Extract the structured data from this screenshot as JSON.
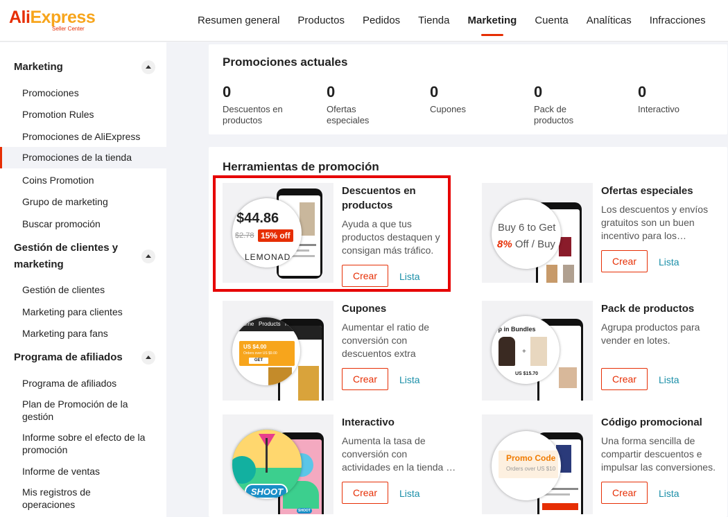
{
  "header": {
    "logo_main_a": "Ali",
    "logo_main_b": "Express",
    "logo_sub": "Seller Center",
    "nav": [
      "Resumen general",
      "Productos",
      "Pedidos",
      "Tienda",
      "Marketing",
      "Cuenta",
      "Analíticas",
      "Infracciones"
    ],
    "active_nav": "Marketing",
    "accent_color": "#e62e04"
  },
  "sidebar": {
    "sections": [
      {
        "title": "Marketing",
        "items": [
          "Promociones",
          "Promotion Rules",
          "Promociones de AliExpress",
          "Promociones de la tienda",
          "Coins Promotion",
          "Grupo de marketing",
          "Buscar promoción"
        ]
      },
      {
        "title": "Gestión de clientes y marketing",
        "items": [
          "Gestión de clientes",
          "Marketing para clientes",
          "Marketing para fans"
        ]
      },
      {
        "title": "Programa de afiliados",
        "items": [
          "Programa de afiliados",
          "Plan de Promoción de la gestión",
          "Informe sobre el efecto de la promoción",
          "Informe de ventas",
          "Mis registros de operaciones"
        ]
      }
    ],
    "active_item": "Promociones de la tienda"
  },
  "current": {
    "title": "Promociones actuales",
    "stats": [
      {
        "value": "0",
        "label": "Descuentos en productos"
      },
      {
        "value": "0",
        "label": "Ofertas especiales"
      },
      {
        "value": "0",
        "label": "Cupones"
      },
      {
        "value": "0",
        "label": "Pack de productos"
      },
      {
        "value": "0",
        "label": "Interactivo"
      }
    ]
  },
  "tools": {
    "title": "Herramientas de promoción",
    "crear_label": "Crear",
    "lista_label": "Lista",
    "items": [
      {
        "title": "Descuentos en productos",
        "desc": "Ayuda a que tus productos destaquen y consigan más tráfico.",
        "img": {
          "price": "$44.86",
          "old_price": "$2.78",
          "badge": "15% off",
          "caption": "LEMONAD"
        }
      },
      {
        "title": "Ofertas especiales",
        "desc": "Los descuentos y envíos gratuitos son un buen incentivo para los…",
        "img": {
          "line1": "Buy 6 to Get",
          "pct": "8%",
          "line2": " Off / Buy"
        }
      },
      {
        "title": "Cupones",
        "desc": "Aumentar el ratio de conversión con descuentos extra",
        "img": {
          "tab1": "Home",
          "tab2": "Products",
          "tab3": "Ne",
          "coupon": "US $4.00",
          "coupon_sub": "Orders over US $9.00",
          "get": "GET"
        }
      },
      {
        "title": "Pack de productos",
        "desc": "Agrupa productos para vender en lotes.",
        "img": {
          "banner": "op in Bundles",
          "price": "US $15.70"
        }
      },
      {
        "title": "Interactivo",
        "desc": "Aumenta la tasa de conversión con actividades en la tienda …",
        "img": {
          "shoot": "SHOOT",
          "shoot_small": "SHOOT"
        }
      },
      {
        "title": "Código promocional",
        "desc": "Una forma sencilla de compartir descuentos e impulsar las conversiones.",
        "img": {
          "code": "Promo Code",
          "code_sub": "Orders over US $10"
        }
      }
    ]
  }
}
